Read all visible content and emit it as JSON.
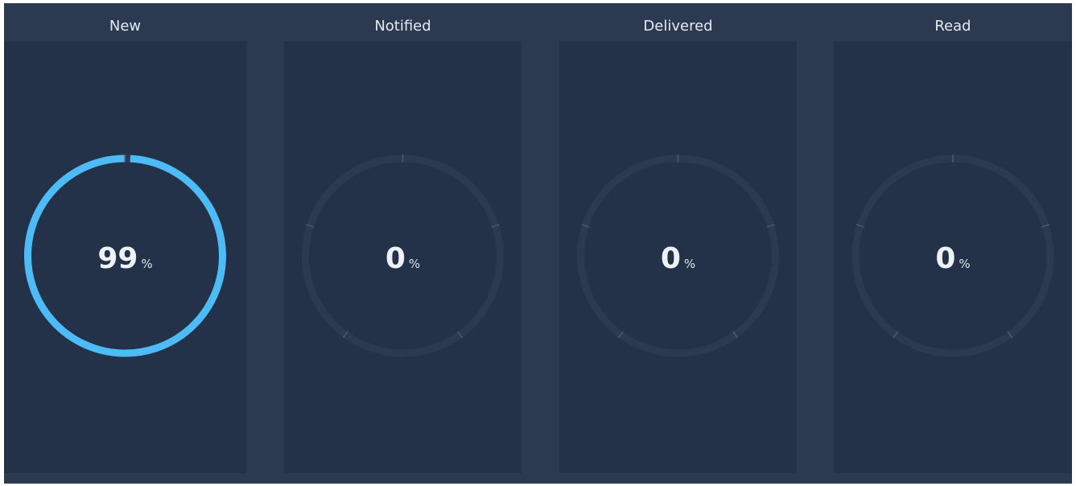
{
  "gauges": [
    {
      "label": "New",
      "value": "99",
      "unit": "%",
      "progress": 0.99
    },
    {
      "label": "Notified",
      "value": "0",
      "unit": "%",
      "progress": 0
    },
    {
      "label": "Delivered",
      "value": "0",
      "unit": "%",
      "progress": 0
    },
    {
      "label": "Read",
      "value": "0",
      "unit": "%",
      "progress": 0
    }
  ],
  "colors": {
    "background": "#2c3a51",
    "panel": "#233249",
    "track": "#2c3a51",
    "progress": "#4dbbf5",
    "tick": "#4a5870",
    "text": "#eef2f7"
  }
}
